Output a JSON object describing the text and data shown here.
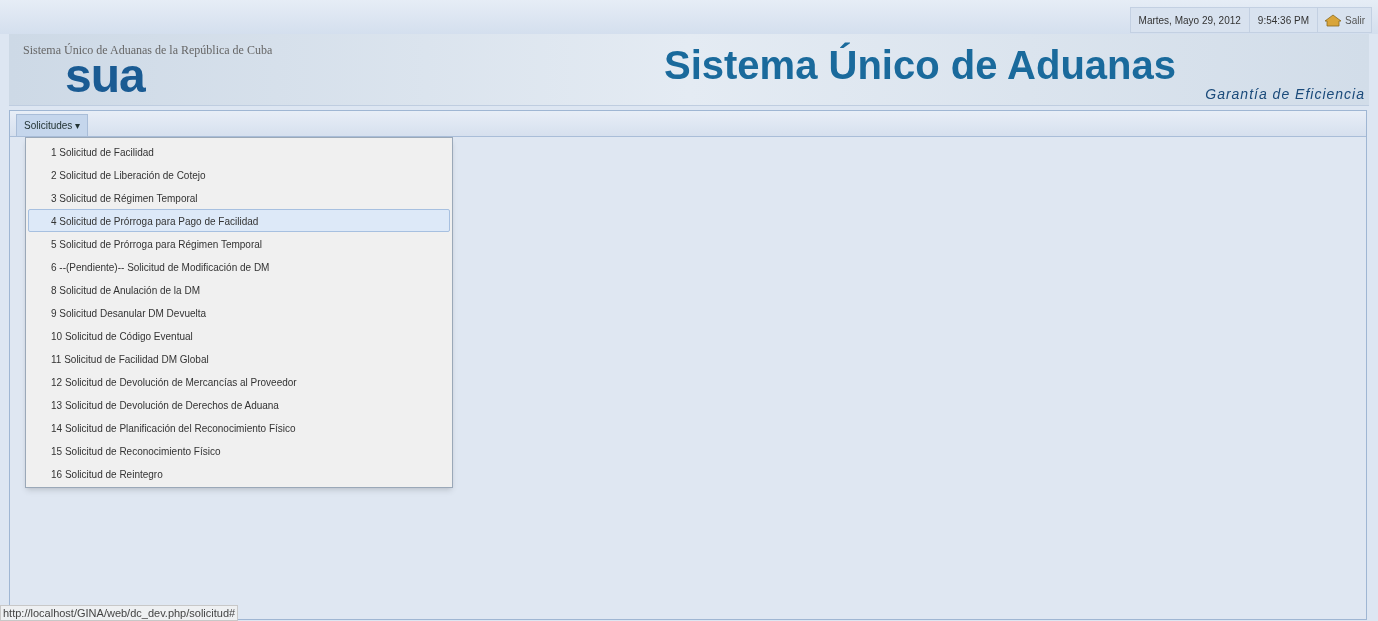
{
  "header": {
    "date": "Martes, Mayo 29, 2012",
    "time": "9:54:36 PM",
    "logout": "Salir"
  },
  "banner": {
    "subtitle": "Sistema Único de Aduanas de la República de Cuba",
    "logo": "sua",
    "title": "Sistema Único de Aduanas",
    "tagline": "Garantía de Eficiencia"
  },
  "menubar": {
    "menu": {
      "label": "Solicitudes",
      "caret": "▾",
      "expanded": true,
      "items": [
        {
          "label": "1 Solicitud de Facilidad",
          "selected": false
        },
        {
          "label": "2 Solicitud de Liberación de Cotejo",
          "selected": false
        },
        {
          "label": "3 Solicitud de Régimen Temporal",
          "selected": false
        },
        {
          "label": "4 Solicitud de Prórroga para Pago de Facilidad",
          "selected": true
        },
        {
          "label": "5 Solicitud de Prórroga para Régimen Temporal",
          "selected": false
        },
        {
          "label": "6 --(Pendiente)-- Solicitud de Modificación de DM",
          "selected": false
        },
        {
          "label": "8 Solicitud de Anulación de la DM",
          "selected": false
        },
        {
          "label": "9 Solicitud Desanular DM Devuelta",
          "selected": false
        },
        {
          "label": "10 Solicitud de Código Eventual",
          "selected": false
        },
        {
          "label": "11 Solicitud de Facilidad DM Global",
          "selected": false
        },
        {
          "label": "12 Solicitud de Devolución de Mercancías al Proveedor",
          "selected": false
        },
        {
          "label": "13 Solicitud de Devolución de Derechos de Aduana",
          "selected": false
        },
        {
          "label": "14 Solicitud de Planificación del Reconocimiento Físico",
          "selected": false
        },
        {
          "label": "15 Solicitud de Reconocimiento Físico",
          "selected": false
        },
        {
          "label": "16 Solicitud de Reintegro",
          "selected": false
        }
      ]
    }
  },
  "status_bar": {
    "url": "http://localhost/GINA/web/dc_dev.php/solicitud#"
  }
}
